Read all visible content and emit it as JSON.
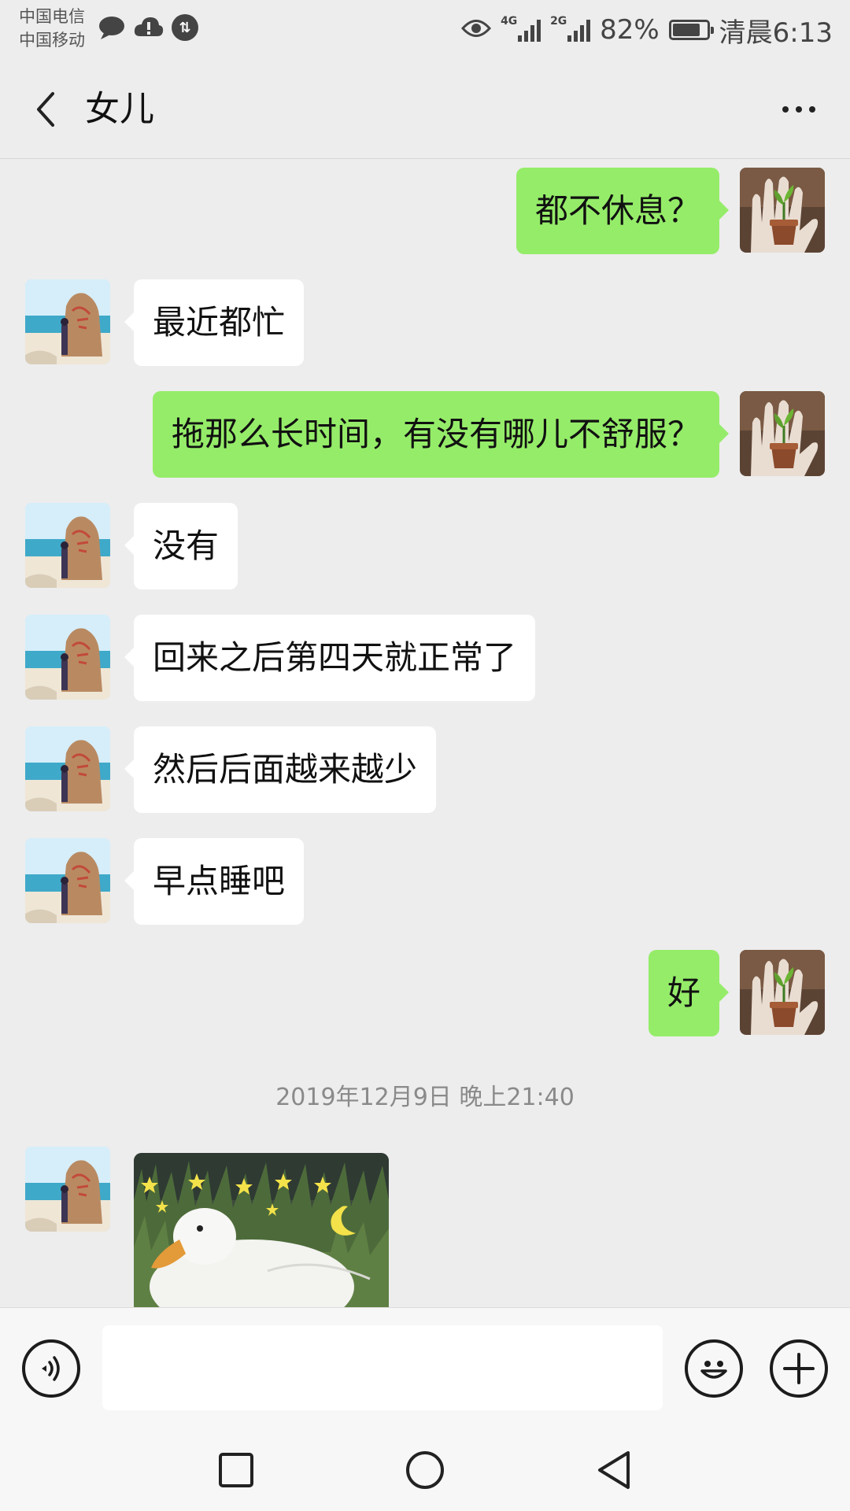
{
  "status_bar": {
    "carrier_1": "中国电信",
    "carrier_2": "中国移动",
    "network_1": "4G",
    "network_2": "2G",
    "battery_percent": "82%",
    "battery_level": 0.82,
    "time": "清晨6:13",
    "icons": [
      "message-icon",
      "cloud-alert-icon",
      "data-transfer-icon",
      "eye-icon",
      "signal-icon",
      "battery-icon"
    ]
  },
  "header": {
    "title": "女儿",
    "icons": [
      "back-arrow-icon",
      "more-icon"
    ]
  },
  "messages": [
    {
      "side": "right",
      "text": "都不休息？"
    },
    {
      "side": "left",
      "text": "最近都忙"
    },
    {
      "side": "right",
      "text": "拖那么长时间，有没有哪儿不舒服？"
    },
    {
      "side": "left",
      "text": "没有"
    },
    {
      "side": "left",
      "text": "回来之后第四天就正常了"
    },
    {
      "side": "left",
      "text": "然后后面越来越少"
    },
    {
      "side": "left",
      "text": "早点睡吧"
    },
    {
      "side": "right",
      "text": "好"
    }
  ],
  "timestamp": "2019年12月9日 晚上21:40",
  "image_message": {
    "side": "left",
    "icon": "duck-moon-sticker"
  },
  "input_bar": {
    "value": "",
    "icons": [
      "voice-icon",
      "emoji-icon",
      "plus-icon"
    ]
  },
  "nav_bar": {
    "icons": [
      "recent-apps-icon",
      "home-icon",
      "back-icon"
    ]
  },
  "colors": {
    "background": "#ededed",
    "own_bubble": "#95ec69",
    "other_bubble": "#ffffff",
    "timestamp": "#8a8a8a"
  }
}
